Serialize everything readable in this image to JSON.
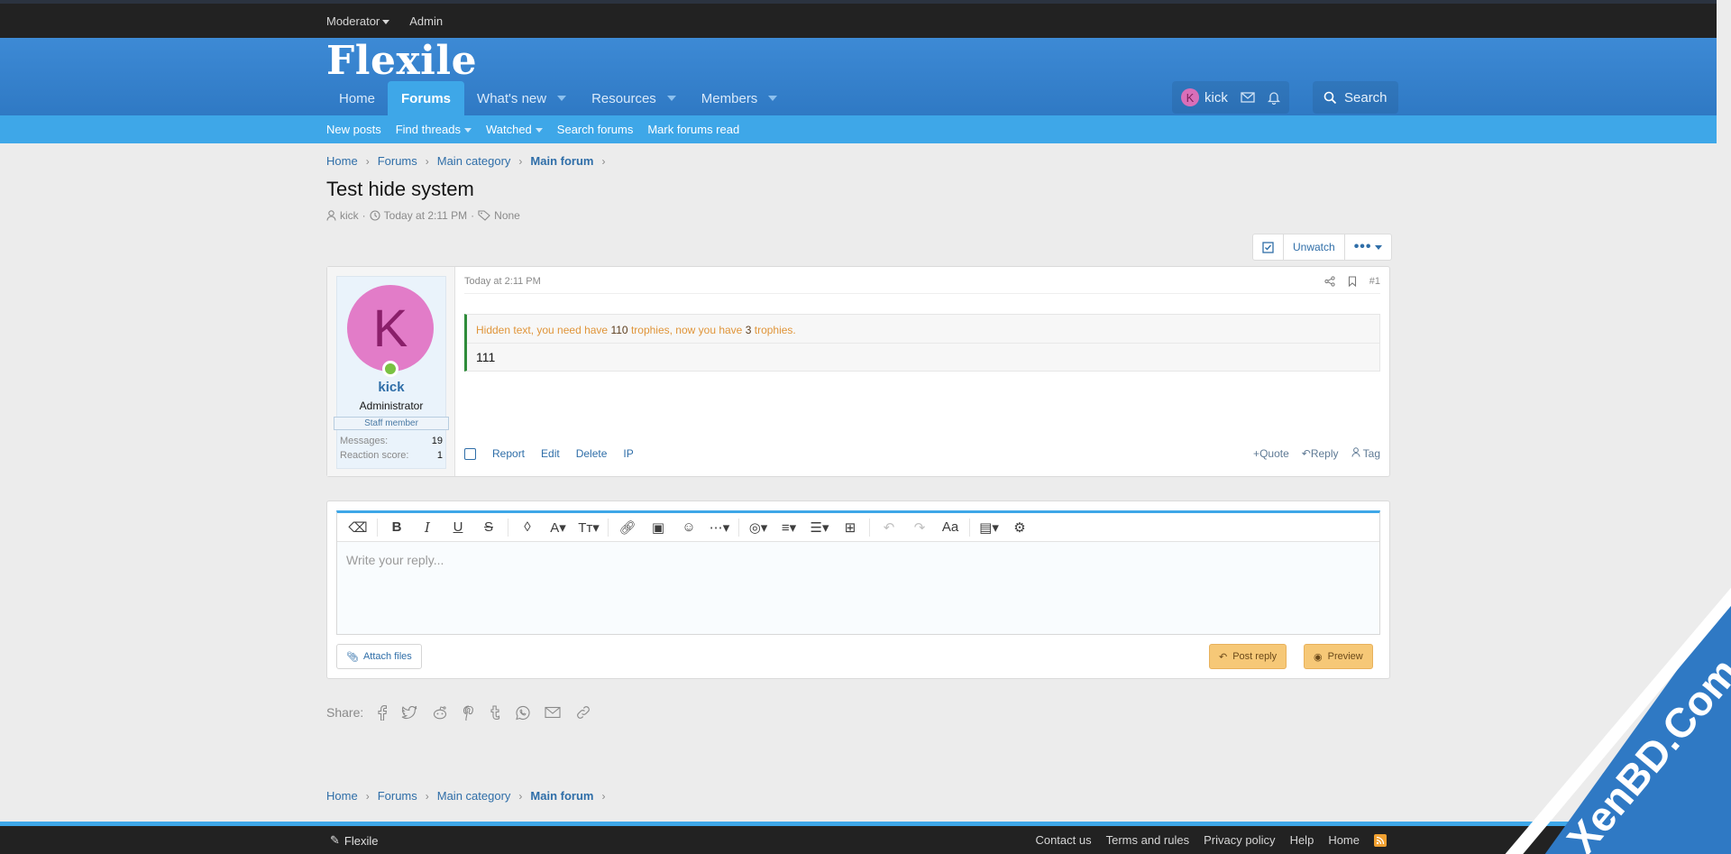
{
  "topbar": {
    "moderator": "Moderator",
    "admin": "Admin"
  },
  "header": {
    "logo": "Flexile",
    "nav": {
      "home": "Home",
      "forums": "Forums",
      "whats_new": "What's new",
      "resources": "Resources",
      "members": "Members"
    },
    "user": {
      "initial": "K",
      "name": "kick"
    },
    "search": "Search"
  },
  "subnav": {
    "new_posts": "New posts",
    "find_threads": "Find threads",
    "watched": "Watched",
    "search_forums": "Search forums",
    "mark_read": "Mark forums read"
  },
  "breadcrumb": {
    "home": "Home",
    "forums": "Forums",
    "category": "Main category",
    "forum": "Main forum"
  },
  "thread": {
    "title": "Test hide system",
    "author": "kick",
    "date": "Today at 2:11 PM",
    "tags": "None",
    "unwatch": "Unwatch"
  },
  "post": {
    "user": {
      "initial": "K",
      "name": "kick",
      "title": "Administrator",
      "banner": "Staff member",
      "messages_label": "Messages:",
      "messages": "19",
      "reaction_label": "Reaction score:",
      "reaction": "1"
    },
    "date": "Today at 2:11 PM",
    "number": "#1",
    "hidden_a": "Hidden text, you need have",
    "hidden_need": "110",
    "hidden_b": "trophies, now you have",
    "hidden_have": "3",
    "hidden_c": "trophies.",
    "content": "111",
    "actions": {
      "report": "Report",
      "edit": "Edit",
      "delete": "Delete",
      "ip": "IP",
      "quote": "Quote",
      "reply": "Reply",
      "tag": "Tag"
    }
  },
  "reply": {
    "placeholder": "Write your reply...",
    "attach": "Attach files",
    "post": "Post reply",
    "preview": "Preview"
  },
  "share": {
    "label": "Share:"
  },
  "footer": {
    "brand": "Flexile",
    "contact": "Contact us",
    "terms": "Terms and rules",
    "privacy": "Privacy policy",
    "help": "Help",
    "home": "Home"
  },
  "watermark": "XenBD.Com",
  "colors": {
    "header": "#3585cf",
    "accent": "#3ea7e8",
    "hidden_note": "#e0953a",
    "button": "#f6c877"
  }
}
